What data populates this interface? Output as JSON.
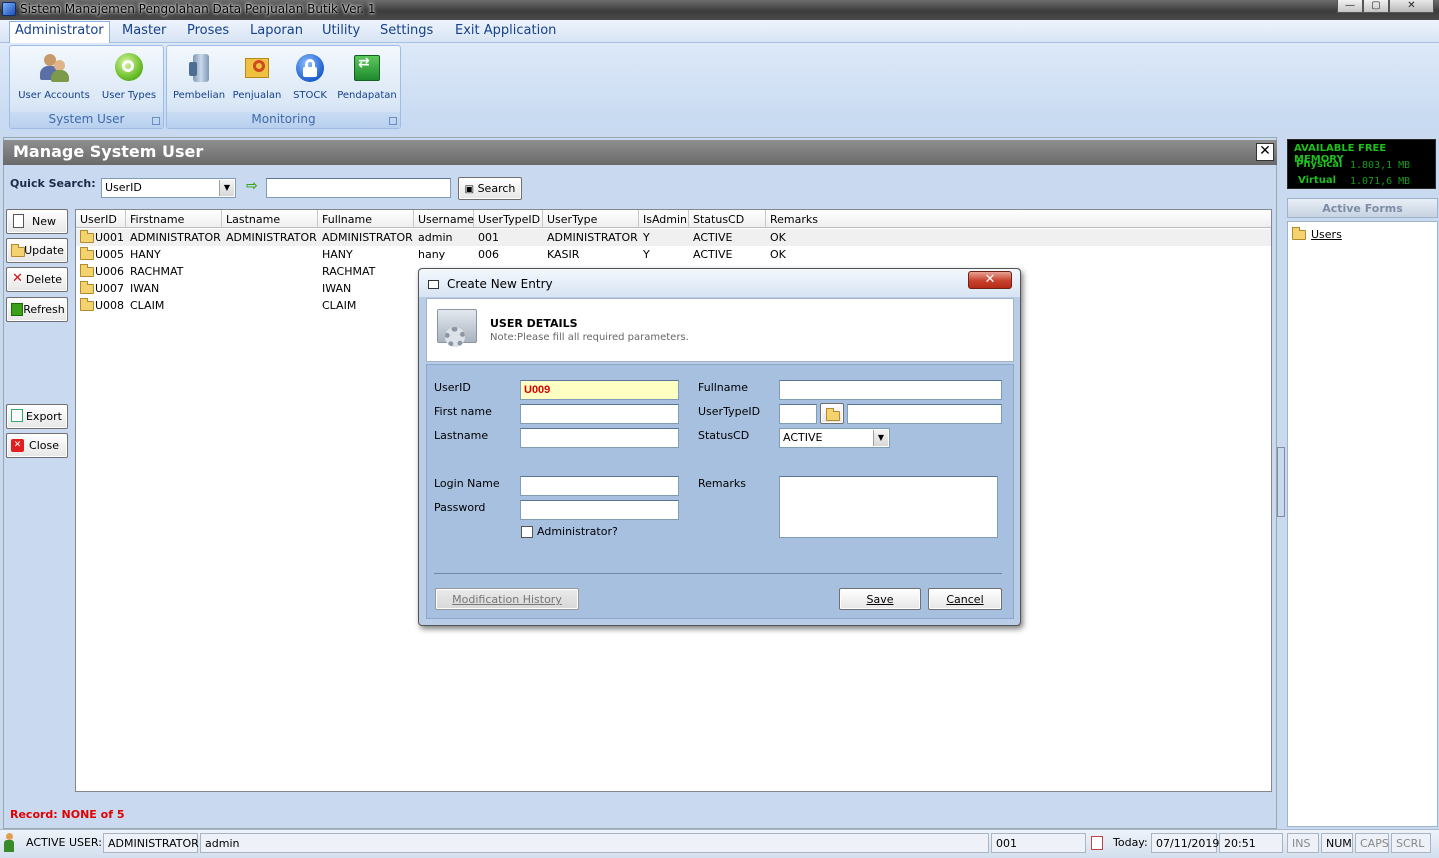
{
  "window": {
    "title": "Sistem Manajemen Pengolahan Data Penjualan Butik Ver. 1",
    "min": "—",
    "max": "▢",
    "close": "✕"
  },
  "menu": [
    "Administrator",
    "Master",
    "Proses",
    "Laporan",
    "Utility",
    "Settings",
    "Exit Application"
  ],
  "ribbon": {
    "system_user": {
      "label": "System User",
      "items": [
        "User Accounts",
        "User Types"
      ]
    },
    "monitoring": {
      "label": "Monitoring",
      "items": [
        "Pembelian",
        "Penjualan",
        "STOCK",
        "Pendapatan"
      ]
    }
  },
  "panel": {
    "title": "Manage System User",
    "quick_search_label": "Quick Search:",
    "search_field": "UserID",
    "search_value": "",
    "search_button": "Search",
    "side_buttons": [
      "New",
      "Update",
      "Delete",
      "Refresh",
      "Export",
      "Close"
    ],
    "record_status": "Record: NONE of 5"
  },
  "grid": {
    "columns": [
      "UserID",
      "Firstname",
      "Lastname",
      "Fullname",
      "Username",
      "UserTypeID",
      "UserType",
      "IsAdmin",
      "StatusCD",
      "Remarks"
    ],
    "rows": [
      [
        "U001",
        "ADMINISTRATOR",
        "ADMINISTRATOR",
        "ADMINISTRATOR",
        "admin",
        "001",
        "ADMINISTRATOR",
        "Y",
        "ACTIVE",
        "OK"
      ],
      [
        "U005",
        "HANY",
        "",
        "HANY",
        "hany",
        "006",
        "KASIR",
        "Y",
        "ACTIVE",
        "OK"
      ],
      [
        "U006",
        "RACHMAT",
        "",
        "RACHMAT",
        "",
        "",
        "",
        "",
        "",
        ""
      ],
      [
        "U007",
        "IWAN",
        "",
        "IWAN",
        "",
        "",
        "",
        "",
        "",
        ""
      ],
      [
        "U008",
        "CLAIM",
        "",
        "CLAIM",
        "",
        "",
        "",
        "",
        "",
        ""
      ]
    ]
  },
  "memory": {
    "title": "AVAILABLE FREE MEMORY",
    "physical_label": "Physical",
    "physical": "1.803,1 MB",
    "virtual_label": "Virtual",
    "virtual": "1.071,6 MB"
  },
  "active_forms": {
    "title": "Active Forms",
    "items": [
      "Users"
    ]
  },
  "dialog": {
    "title": "Create New Entry",
    "header_title": "USER DETAILS",
    "header_note": "Note:Please fill all required parameters.",
    "labels": {
      "userid": "UserID",
      "firstname": "First name",
      "lastname": "Lastname",
      "login": "Login Name",
      "password": "Password",
      "admin": "Administrator?",
      "fullname": "Fullname",
      "usertypeid": "UserTypeID",
      "statuscd": "StatusCD",
      "remarks": "Remarks"
    },
    "values": {
      "userid": "U009",
      "firstname": "",
      "lastname": "",
      "login": "",
      "password": "",
      "fullname": "",
      "usertypeid": "",
      "usertype_name": "",
      "statuscd": "ACTIVE",
      "remarks": "",
      "admin_checked": false
    },
    "buttons": {
      "history": "Modification History",
      "save": "Save",
      "cancel": "Cancel"
    }
  },
  "statusbar": {
    "active_user_label": "ACTIVE USER:",
    "role": "ADMINISTRATOR",
    "username": "admin",
    "code": "001",
    "today_label": "Today:",
    "date": "07/11/2019",
    "time": "20:51",
    "keys": [
      "INS",
      "NUM",
      "CAPS",
      "SCRL"
    ]
  },
  "colors": {
    "accent": "#15428b",
    "record": "#e00000",
    "userid_bg": "#ffffc4",
    "userid_text": "#e00000",
    "memory_text": "#1fbf1f"
  }
}
